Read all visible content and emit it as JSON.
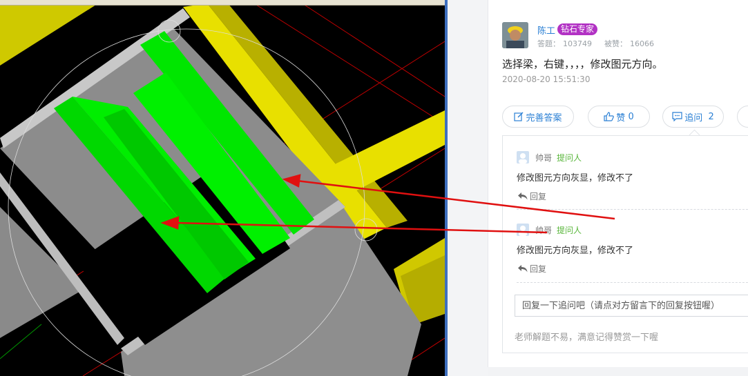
{
  "answer": {
    "user_name": "陈工",
    "badge": "钻石专家",
    "answers_label": "答题：",
    "answers_count": "103749",
    "likes_label": "被赞：",
    "likes_count": "16066",
    "text": "选择梁，右键，，，，修改图元方向。",
    "time": "2020-08-20 15:51:30"
  },
  "actions": {
    "improve_label": "完善答案",
    "like_label": "赞",
    "like_count": "0",
    "followup_label": "追问",
    "followup_count": "2"
  },
  "replies": [
    {
      "name": "帅哥",
      "role": "提问人",
      "text": "修改图元方向灰显，修改不了",
      "reply_label": "回复"
    },
    {
      "name": "帅哥",
      "role": "提问人",
      "text": "修改图元方向灰显，修改不了",
      "reply_label": "回复"
    }
  ],
  "reply_input_placeholder": "回复一下追问吧（请点对方留言下的回复按钮喔）",
  "footer_hint": "老师解题不易，满意记得赞赏一下喔",
  "colors": {
    "link_blue": "#2a7fd4",
    "badge_purple": "#b232c4",
    "role_green": "#58b63a",
    "model_green": "#00e600",
    "model_yellow": "#e8e000",
    "model_gray": "#8c8c8c",
    "arrow_red": "#e01010"
  }
}
